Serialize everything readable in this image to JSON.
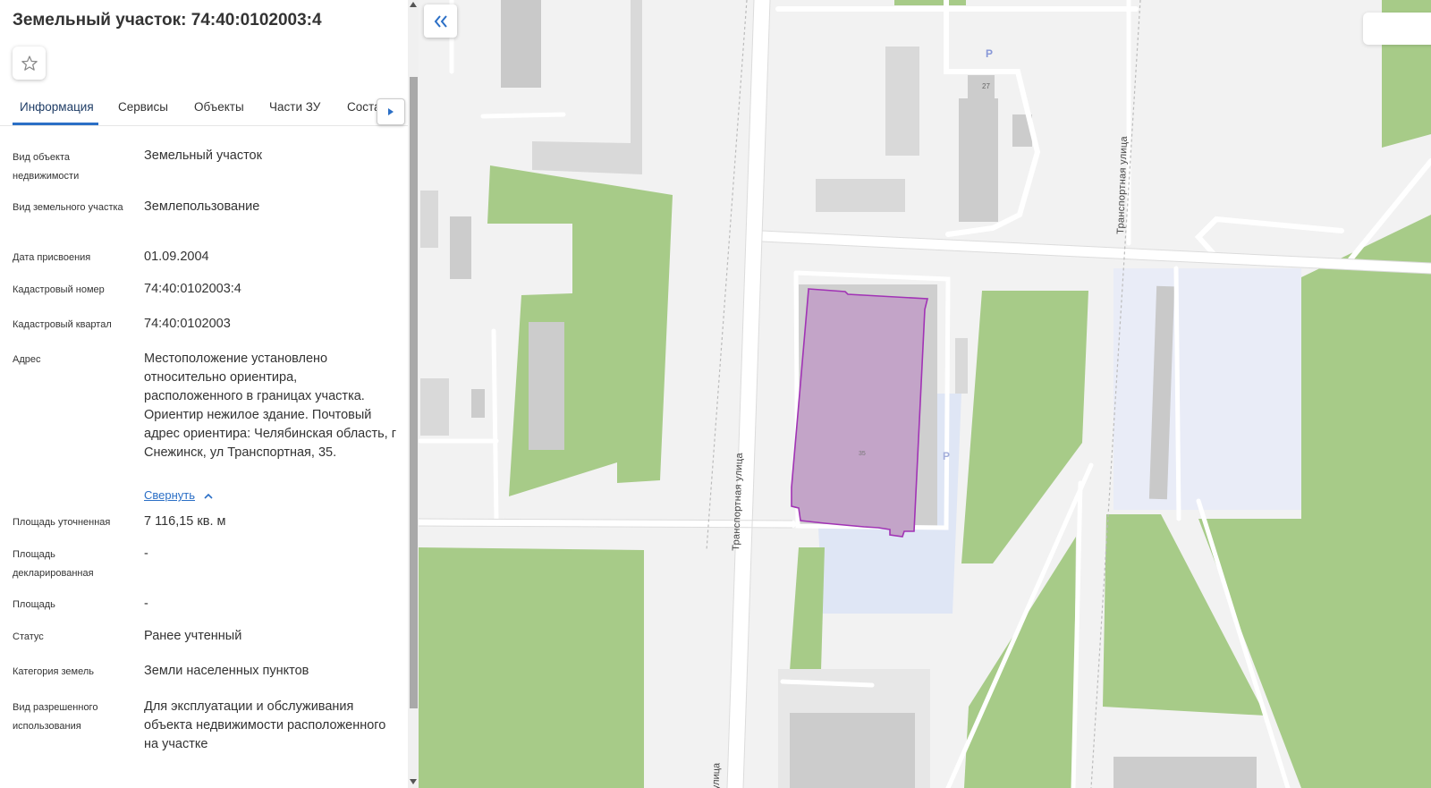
{
  "panel": {
    "title": "Земельный участок: 74:40:0102003:4",
    "tabs": [
      {
        "label": "Информация"
      },
      {
        "label": "Сервисы"
      },
      {
        "label": "Объекты"
      },
      {
        "label": "Части ЗУ"
      },
      {
        "label": "Соста"
      }
    ],
    "active_tab": "Информация",
    "rows": [
      {
        "label": "Вид объекта недвижимости",
        "value": "Земельный участок"
      },
      {
        "label": "Вид земельного участка",
        "value": "Землепользование"
      },
      {
        "label": "Дата присвоения",
        "value": "01.09.2004"
      },
      {
        "label": "Кадастровый номер",
        "value": "74:40:0102003:4"
      },
      {
        "label": "Кадастровый квартал",
        "value": "74:40:0102003"
      },
      {
        "label": "Адрес",
        "value": "Местоположение установлено относительно ориентира, расположенного в границах участка. Ориентир нежилое здание. Почтовый адрес ориентира: Челябинская область, г Снежинск, ул Транспортная, 35."
      },
      {
        "label": "Площадь уточненная",
        "value": "7 116,15 кв. м"
      },
      {
        "label": "Площадь декларированная",
        "value": "-"
      },
      {
        "label": "Площадь",
        "value": "-"
      },
      {
        "label": "Статус",
        "value": "Ранее учтенный"
      },
      {
        "label": "Категория земель",
        "value": "Земли населенных пунктов"
      },
      {
        "label": "Вид разрешенного использования",
        "value": "Для эксплуатации и обслуживания объекта недвижимости расположенного на участке"
      }
    ],
    "collapse_link": "Свернуть"
  },
  "map": {
    "street_label": "Транспортная улица",
    "street_label_bottom": "улица",
    "house_numbers": [
      "27",
      "35"
    ],
    "parking_label": "P",
    "colors": {
      "background": "#f2f2f2",
      "green": "#a7cb88",
      "building": "#d9d9d9",
      "parcel_fill": "#c3a4c8",
      "parcel_stroke": "#a133b5",
      "highlight": "#dfe6f5"
    }
  },
  "icons": {
    "favorite": "star-outline-icon",
    "collapse_panel": "double-chevron-left-icon",
    "tabs_scroll": "triangle-right-icon",
    "collapse_link": "chevron-up-icon"
  }
}
